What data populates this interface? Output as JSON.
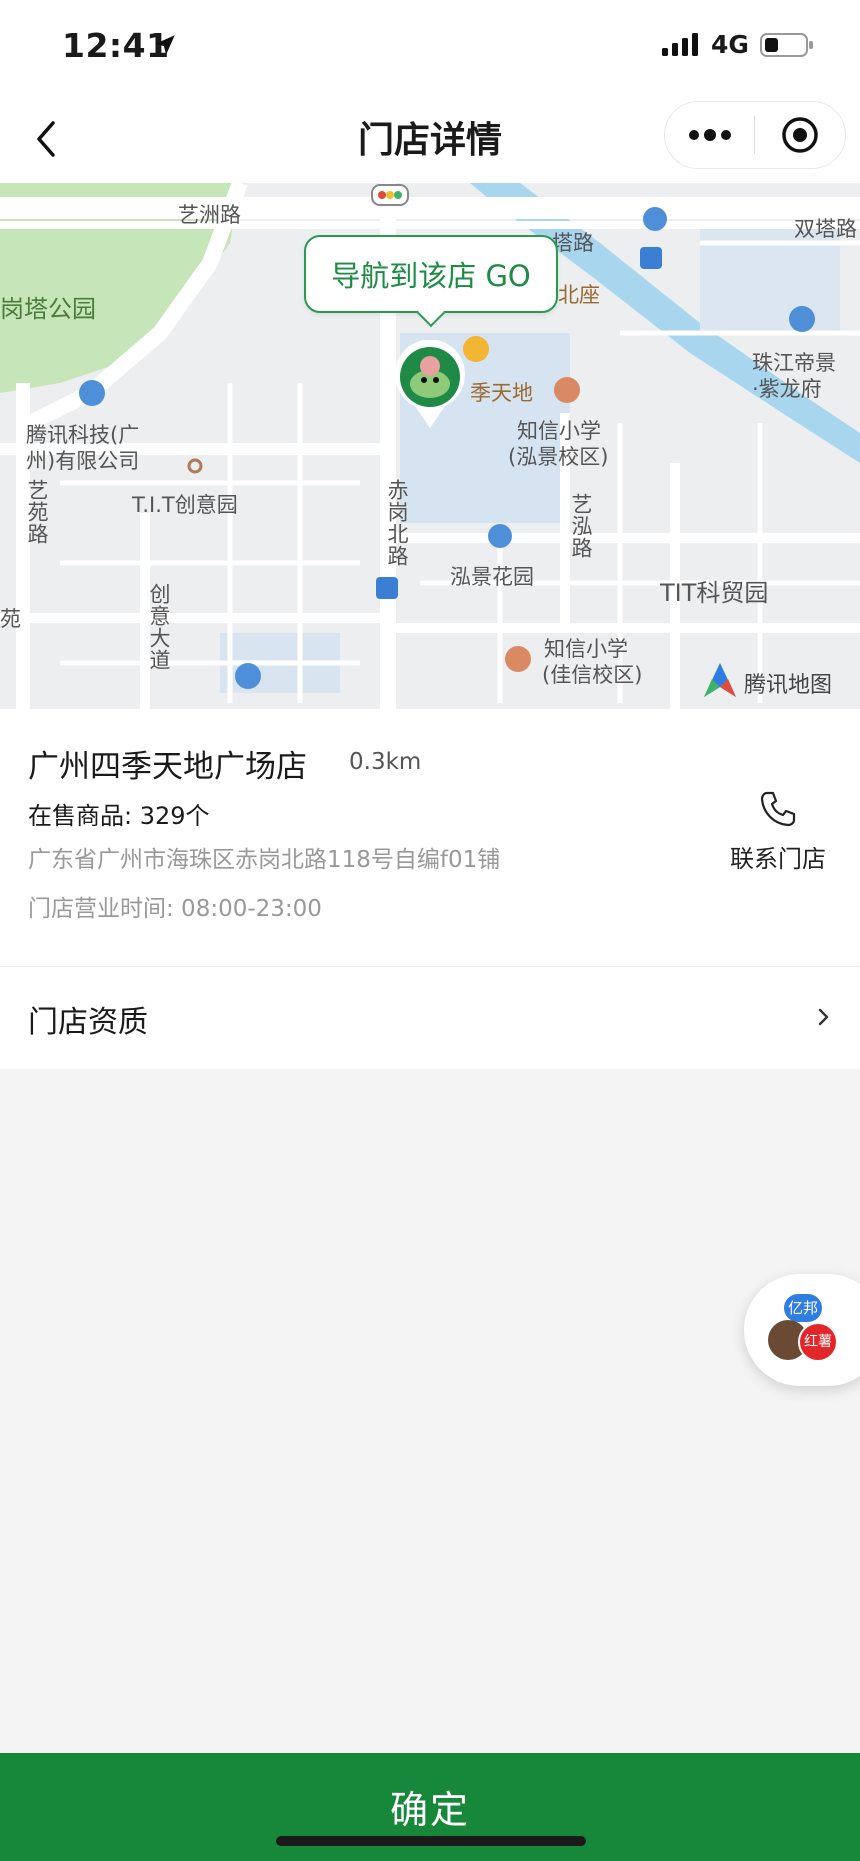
{
  "status_bar": {
    "time": "12:41",
    "network": "4G"
  },
  "nav": {
    "title": "门店详情"
  },
  "map": {
    "navigate_label": "导航到该店 GO",
    "labels": {
      "yizhou_rd": "艺洲路",
      "tower_rd": "塔路",
      "shuangta_rd": "双塔路",
      "north_block": "北座",
      "pagoda_park": "岗塔公园",
      "tencent_company_1": "腾讯科技(广",
      "tencent_company_2": "州)有限公司",
      "zhujiang_1": "珠江帝景",
      "zhujiang_2": "·紫龙府",
      "siji": "季天地",
      "zhixin_1a": "知信小学",
      "zhixin_1b": "(泓景校区)",
      "tit_park": "T.I.T创意园",
      "yiyuan_rd": "艺苑路",
      "chigang_rd": "赤岗北路",
      "yihong_rd": "艺泓路",
      "hongjing_garden": "泓景花园",
      "tit_keimao": "TIT科贸园",
      "chuangyi_rd": "创意大道",
      "zhixin_2a": "知信小学",
      "zhixin_2b": "(佳信校区)",
      "yuan": "苑",
      "tencent_map": "腾讯地图"
    }
  },
  "store": {
    "name": "广州四季天地广场店",
    "distance": "0.3km",
    "goods_count": "在售商品: 329个",
    "address": "广东省广州市海珠区赤岗北路118号自编f01铺",
    "hours": "门店营业时间: 08:00-23:00",
    "contact_label": "联系门店"
  },
  "qualification": {
    "label": "门店资质"
  },
  "float_widget": {
    "badge_top": "亿邦",
    "badge_bottom": "红薯"
  },
  "footer": {
    "confirm_label": "确定"
  },
  "colors": {
    "brand_green": "#17883a",
    "bubble_green": "#1f8b45"
  }
}
